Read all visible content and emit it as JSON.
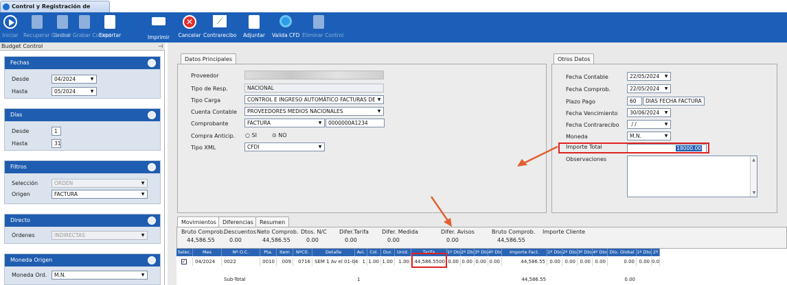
{
  "window": {
    "tab_title": "Control y Registración de Factura..."
  },
  "toolbar": [
    {
      "label": "Iniciar",
      "enabled": false,
      "icon": "play-icon"
    },
    {
      "label": "Recuperar Control",
      "enabled": false,
      "icon": "recover-icon"
    },
    {
      "label": "Grabar",
      "enabled": false,
      "icon": "save-icon"
    },
    {
      "label": "Grabar Control",
      "enabled": false,
      "icon": "save-control-icon"
    },
    {
      "label": "Exportar",
      "enabled": true,
      "icon": "export-icon"
    },
    {
      "label": "Imprimir",
      "enabled": true,
      "icon": "print-icon"
    },
    {
      "label": "Cancelar",
      "enabled": true,
      "icon": "cancel-icon"
    },
    {
      "label": "Contrarecibo",
      "enabled": true,
      "icon": "chart-icon"
    },
    {
      "label": "Adjuntar",
      "enabled": true,
      "icon": "attach-icon"
    },
    {
      "label": "Valida CFD",
      "enabled": true,
      "icon": "validate-icon"
    },
    {
      "label": "Eliminar Control",
      "enabled": false,
      "icon": "delete-icon"
    }
  ],
  "sidebar": {
    "title": "Budget Control",
    "fechas": {
      "title": "Fechas",
      "desde_label": "Desde",
      "desde_value": "04/2024",
      "hasta_label": "Hasta",
      "hasta_value": "05/2024"
    },
    "dias": {
      "title": "Días",
      "desde_label": "Desde",
      "desde_value": "1",
      "hasta_label": "Hasta",
      "hasta_value": "31"
    },
    "filtros": {
      "title": "Filtros",
      "seleccion_label": "Selección",
      "seleccion_value": "ORDEN",
      "origen_label": "Origen",
      "origen_value": "FACTURA"
    },
    "directo": {
      "title": "Directo",
      "ordenes_label": "Órdenes",
      "ordenes_value": "INDIRECTAS"
    },
    "moneda": {
      "title": "Moneda Origen",
      "label": "Moneda Ord.",
      "value": "M.N."
    }
  },
  "datos": {
    "tab": "Datos Principales",
    "proveedor_label": "Proveedor",
    "tipo_resp_label": "Tipo de Resp.",
    "tipo_resp_value": "NACIONAL",
    "tipo_carga_label": "Tipo Carga",
    "tipo_carga_value": "CONTROL E INGRESO AUTOMÁTICO FACTURAS DE MEC",
    "cuenta_label": "Cuenta Contable",
    "cuenta_value": "PROVEEDORES MEDIOS NACIONALES",
    "comprobante_label": "Comprobante",
    "comprobante_value": "FACTURA",
    "comprobante_num": "0000000A1234",
    "compra_label": "Compra Anticip.",
    "si_label": "SI",
    "no_label": "NO",
    "tipo_xml_label": "Tipo XML",
    "tipo_xml_value": "CFDI"
  },
  "otros": {
    "tab": "Otros Datos",
    "fecha_contable_label": "Fecha Contable",
    "fecha_contable_value": "22/05/2024",
    "fecha_comprob_label": "Fecha Comprob.",
    "fecha_comprob_value": "22/05/2024",
    "plazo_label": "Plazo Pago",
    "plazo_value": "60",
    "plazo_text": "DIAS FECHA FACTURA",
    "fecha_venc_label": "Fecha Vencimiento",
    "fecha_venc_value": "30/06/2024",
    "fecha_contra_label": "Fecha Contrarecibo",
    "fecha_contra_value": " / /",
    "moneda_label": "Moneda",
    "moneda_value": "M.N.",
    "importe_label": "Importe Total",
    "importe_value": "18000.00",
    "obs_label": "Observaciones"
  },
  "mov_tabs": [
    "Movimientos",
    "Diferencias",
    "Resumen"
  ],
  "summary": [
    {
      "label": "Bruto Comprob.",
      "value": "44,586.55"
    },
    {
      "label": "Descuentos",
      "value": "0.00"
    },
    {
      "label": "Neto Comprob.",
      "value": "44,586.55"
    },
    {
      "label": "Dtos. N/C",
      "value": "0.00"
    },
    {
      "label": "Difer.Tarifa",
      "value": "0.00"
    },
    {
      "label": "Difer. Medida",
      "value": "0.00"
    },
    {
      "label": "Difer. Avisos",
      "value": "0.00"
    },
    {
      "label": "Bruto Comprob.",
      "value": "44,586.55"
    },
    {
      "label": "Importe Cliente",
      "value": ""
    }
  ],
  "grid": {
    "headers": [
      "Selec.",
      "Mes",
      "Nº O.C.",
      "Pta.",
      "Item",
      "NºCtl.",
      "Detalle",
      "Avi.",
      "Col.",
      "Dur.",
      "Unid.",
      "Tarifa",
      "1º Dto",
      "2º Dto",
      "3º Dto",
      "4º Dto",
      "Importe Fact.",
      "1º Dto",
      "2º Dto",
      "3º Dto",
      "4º Dto",
      "Dto. Global",
      "1º Dto",
      "2º"
    ],
    "row": [
      "",
      "04/2024",
      "0022",
      "0010",
      "009",
      "0716",
      "SEM 1 Av el 01-04",
      "1",
      "1.00",
      "1.00",
      "1.00",
      "44,586.5500",
      "0.00",
      "0.00",
      "0.00",
      "0.00",
      "44,586.55",
      "0.00",
      "0.00",
      "0.00",
      "0.00",
      "0.00",
      "0.00",
      "0.0"
    ],
    "subtotal_label": "Sub-Total",
    "subtotal_avi": "1",
    "subtotal_importe": "44,586.55",
    "subtotal_global": "0.00"
  }
}
